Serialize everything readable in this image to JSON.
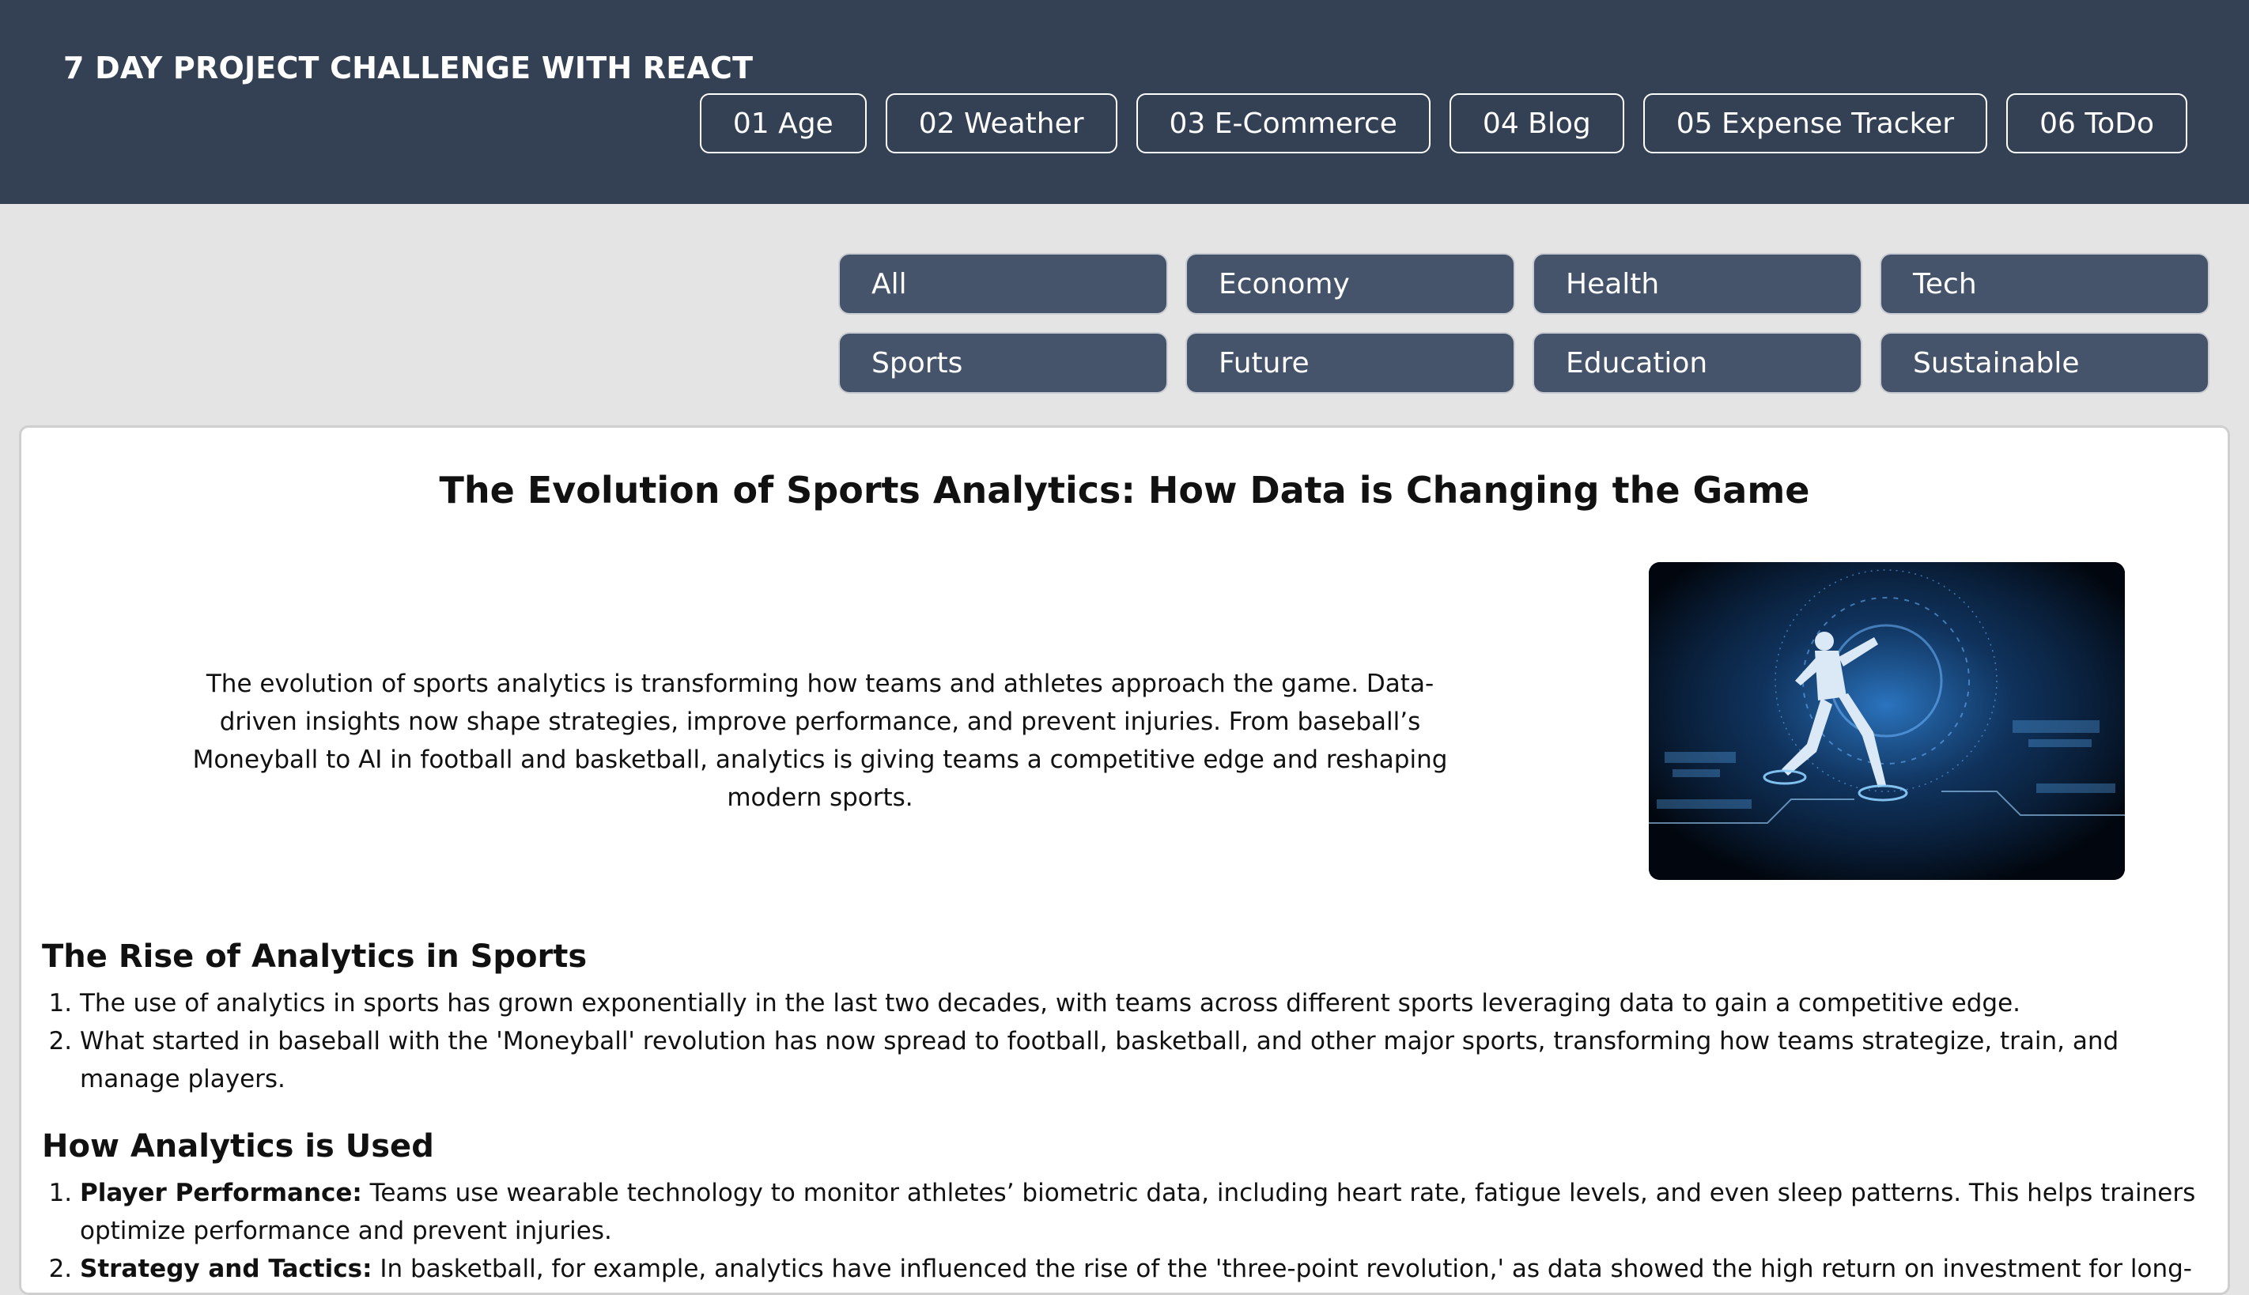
{
  "header": {
    "brand": "7 DAY PROJECT CHALLENGE WITH REACT",
    "nav": [
      {
        "label": "01 Age"
      },
      {
        "label": "02 Weather"
      },
      {
        "label": "03 E-Commerce"
      },
      {
        "label": "04 Blog"
      },
      {
        "label": "05 Expense Tracker"
      },
      {
        "label": "06 ToDo"
      }
    ]
  },
  "filters": [
    {
      "label": "All"
    },
    {
      "label": "Economy"
    },
    {
      "label": "Health"
    },
    {
      "label": "Tech"
    },
    {
      "label": "Sports"
    },
    {
      "label": "Future"
    },
    {
      "label": "Education"
    },
    {
      "label": "Sustainable"
    }
  ],
  "article": {
    "title": "The Evolution of Sports Analytics: How Data is Changing the Game",
    "intro": "The evolution of sports analytics is transforming how teams and athletes approach the game. Data-driven insights now shape strategies, improve performance, and prevent injuries. From baseball’s Moneyball to AI in football and basketball, analytics is giving teams a competitive edge and reshaping modern sports.",
    "sections": [
      {
        "heading": "The Rise of Analytics in Sports",
        "items": [
          {
            "strong": "",
            "text": "The use of analytics in sports has grown exponentially in the last two decades, with teams across different sports leveraging data to gain a competitive edge."
          },
          {
            "strong": "",
            "text": "What started in baseball with the 'Moneyball' revolution has now spread to football, basketball, and other major sports, transforming how teams strategize, train, and manage players."
          }
        ]
      },
      {
        "heading": "How Analytics is Used",
        "items": [
          {
            "strong": "Player Performance:",
            "text": " Teams use wearable technology to monitor athletes’ biometric data, including heart rate, fatigue levels, and even sleep patterns. This helps trainers optimize performance and prevent injuries."
          },
          {
            "strong": "Strategy and Tactics:",
            "text": " In basketball, for example, analytics have influenced the rise of the 'three-point revolution,' as data showed the high return on investment for long-range shots."
          }
        ]
      }
    ]
  },
  "colors": {
    "header_bg": "#344154",
    "filter_bg": "#45546a",
    "page_bg": "#e4e4e4"
  }
}
